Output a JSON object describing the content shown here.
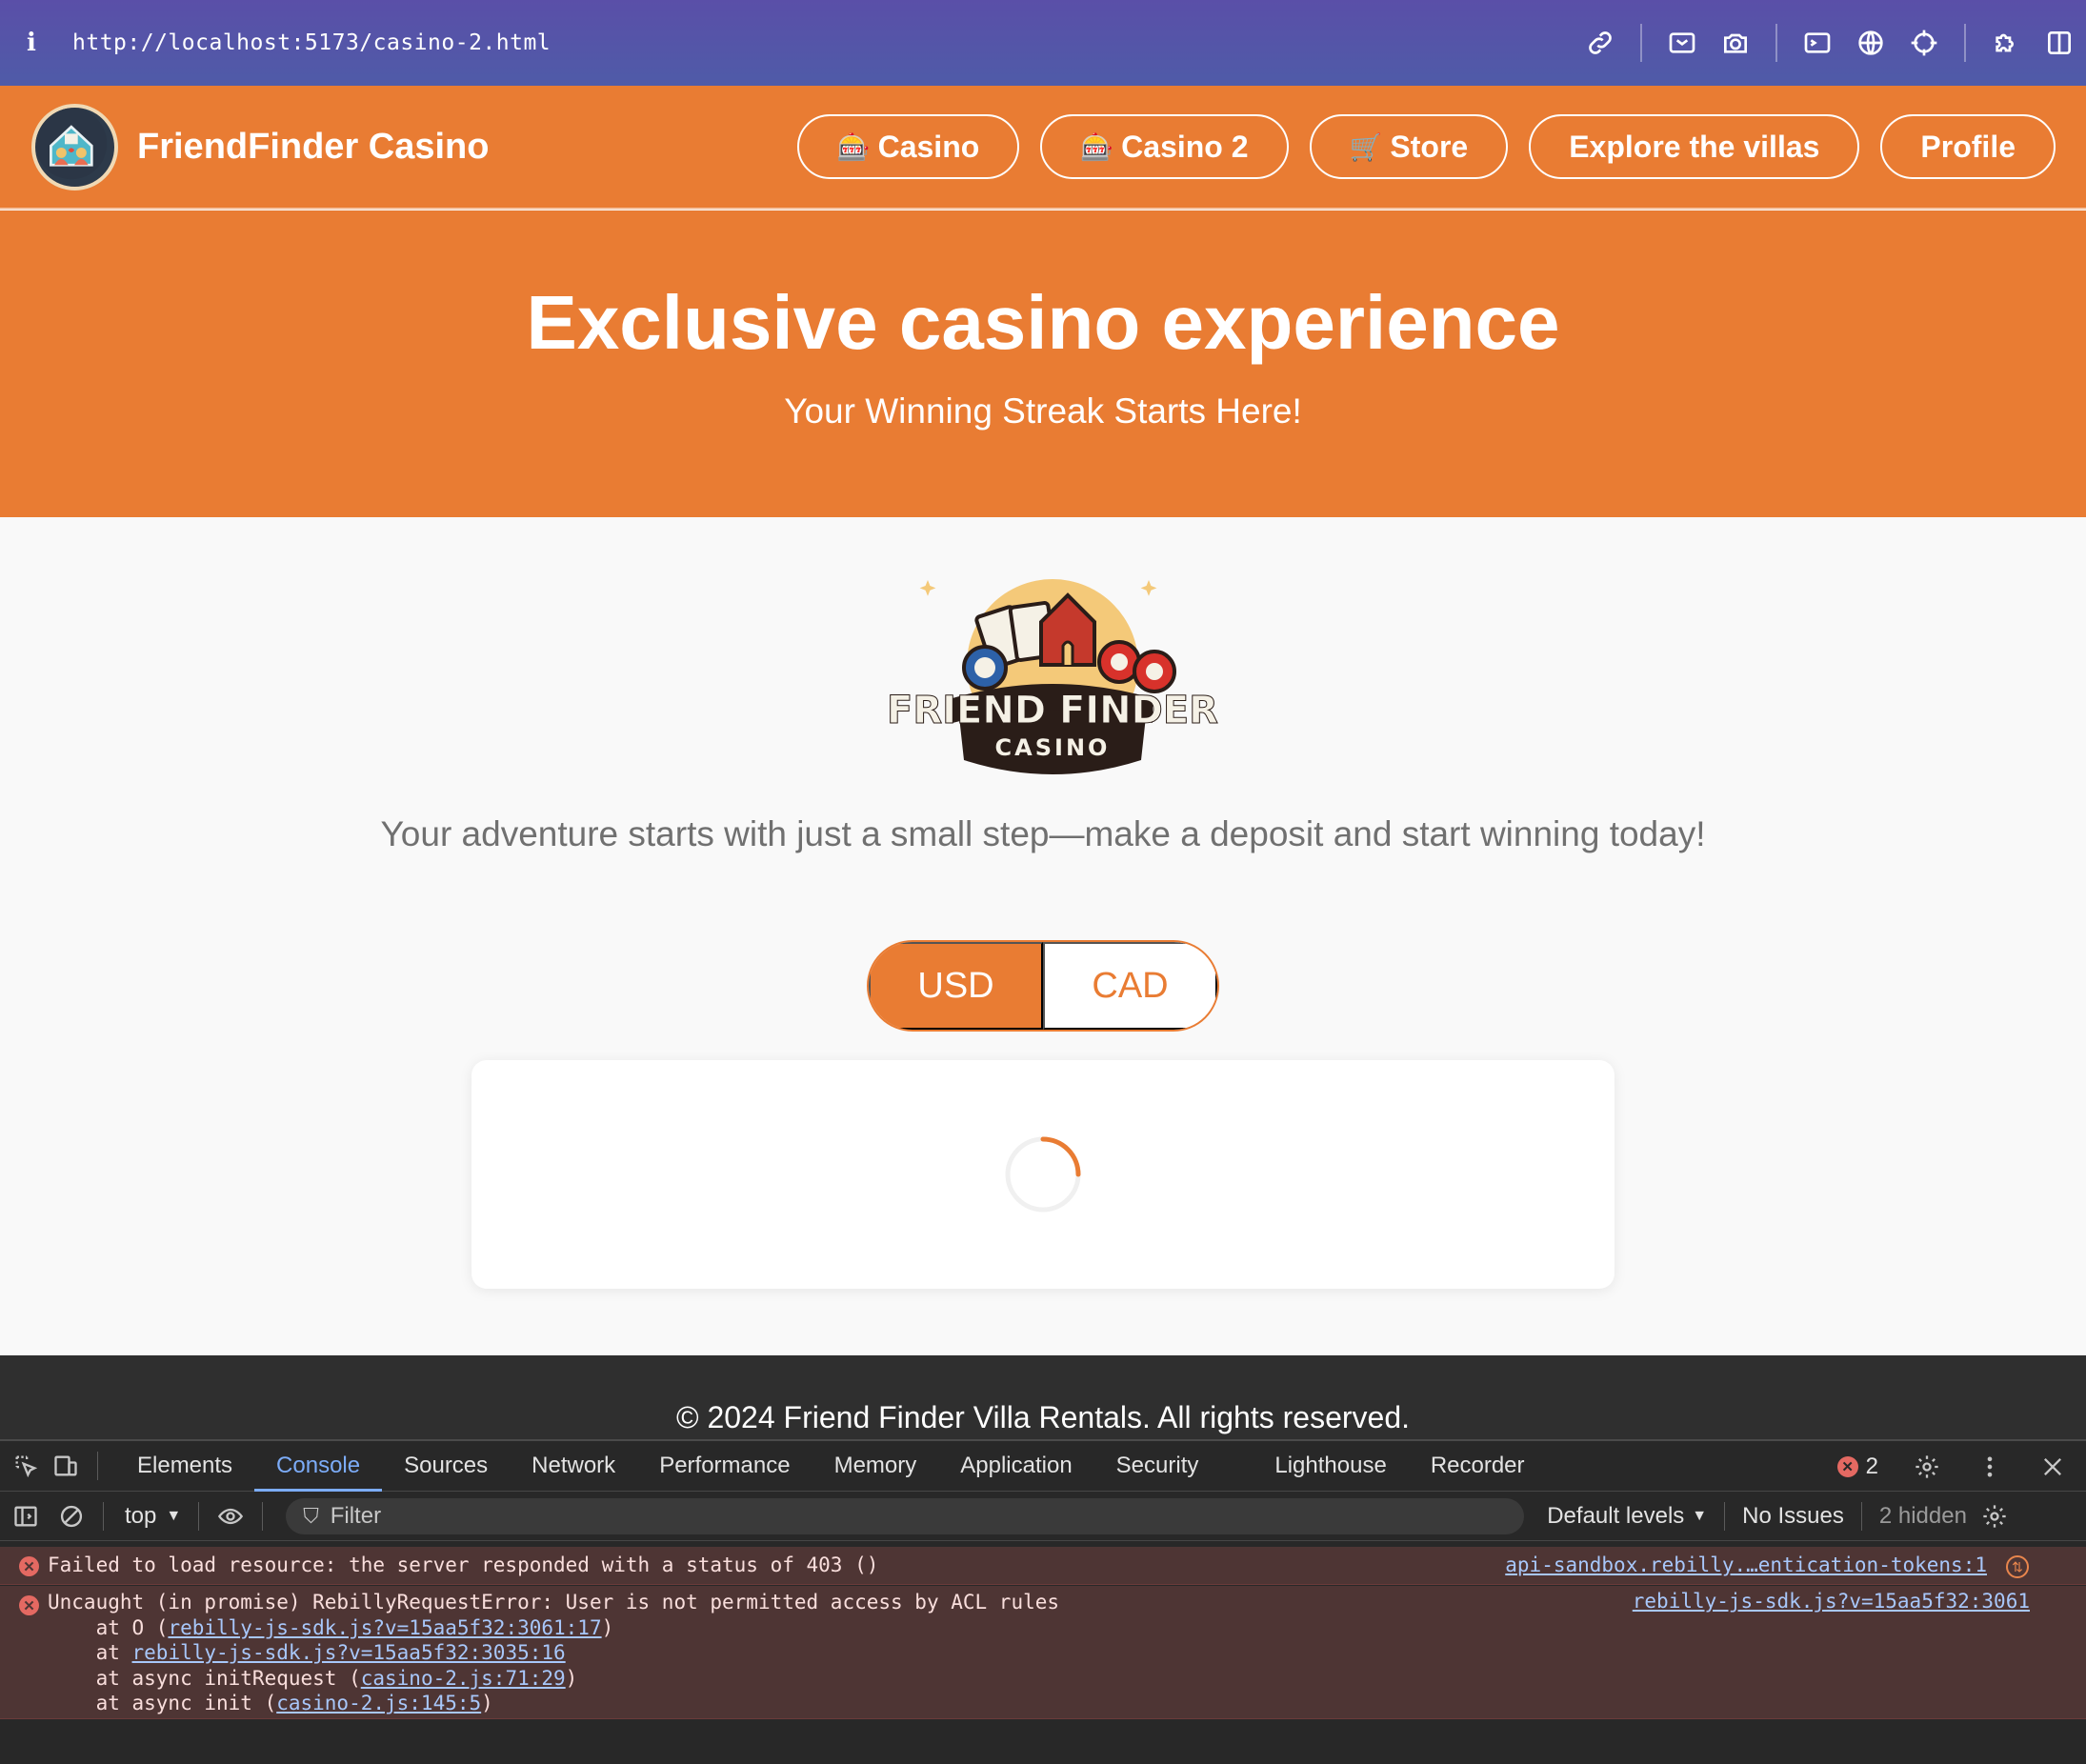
{
  "browser": {
    "url": "http://localhost:5173/casino-2.html",
    "info_icon": "i"
  },
  "site": {
    "brand": "FriendFinder Casino",
    "nav": [
      {
        "icon": "🎰",
        "label": "Casino"
      },
      {
        "icon": "🎰",
        "label": "Casino 2"
      },
      {
        "icon": "🛒",
        "label": "Store"
      },
      {
        "icon": "",
        "label": "Explore the villas"
      },
      {
        "icon": "",
        "label": "Profile"
      }
    ],
    "hero_title": "Exclusive casino experience",
    "hero_subtitle": "Your Winning Streak Starts Here!",
    "logo_text_main": "FRIEND FINDER",
    "logo_text_sub": "CASINO",
    "tagline": "Your adventure starts with just a small step—make a deposit and start winning today!",
    "currency": {
      "options": [
        "USD",
        "CAD"
      ],
      "selected": "USD"
    },
    "footer": "© 2024 Friend Finder Villa Rentals. All rights reserved.",
    "accent_color": "#e97c33"
  },
  "devtools": {
    "tabs": [
      "Elements",
      "Console",
      "Sources",
      "Network",
      "Performance",
      "Memory",
      "Application",
      "Security",
      "Lighthouse",
      "Recorder"
    ],
    "active_tab": "Console",
    "error_count": "2",
    "context": "top",
    "filter_placeholder": "Filter",
    "levels": "Default levels",
    "issues": "No Issues",
    "hidden": "2 hidden",
    "messages": [
      {
        "text": "Failed to load resource: the server responded with a status of 403 ()",
        "source": "api-sandbox.rebilly.…entication-tokens:1"
      },
      {
        "text": "Uncaught (in promise) RebillyRequestError: User is not permitted access by ACL rules",
        "source": "rebilly-js-sdk.js?v=15aa5f32:3061",
        "stack": [
          {
            "prefix": "    at O (",
            "link": "rebilly-js-sdk.js?v=15aa5f32:3061:17",
            "suffix": ")"
          },
          {
            "prefix": "    at ",
            "link": "rebilly-js-sdk.js?v=15aa5f32:3035:16",
            "suffix": ""
          },
          {
            "prefix": "    at async initRequest (",
            "link": "casino-2.js:71:29",
            "suffix": ")"
          },
          {
            "prefix": "    at async init (",
            "link": "casino-2.js:145:5",
            "suffix": ")"
          }
        ]
      }
    ]
  }
}
